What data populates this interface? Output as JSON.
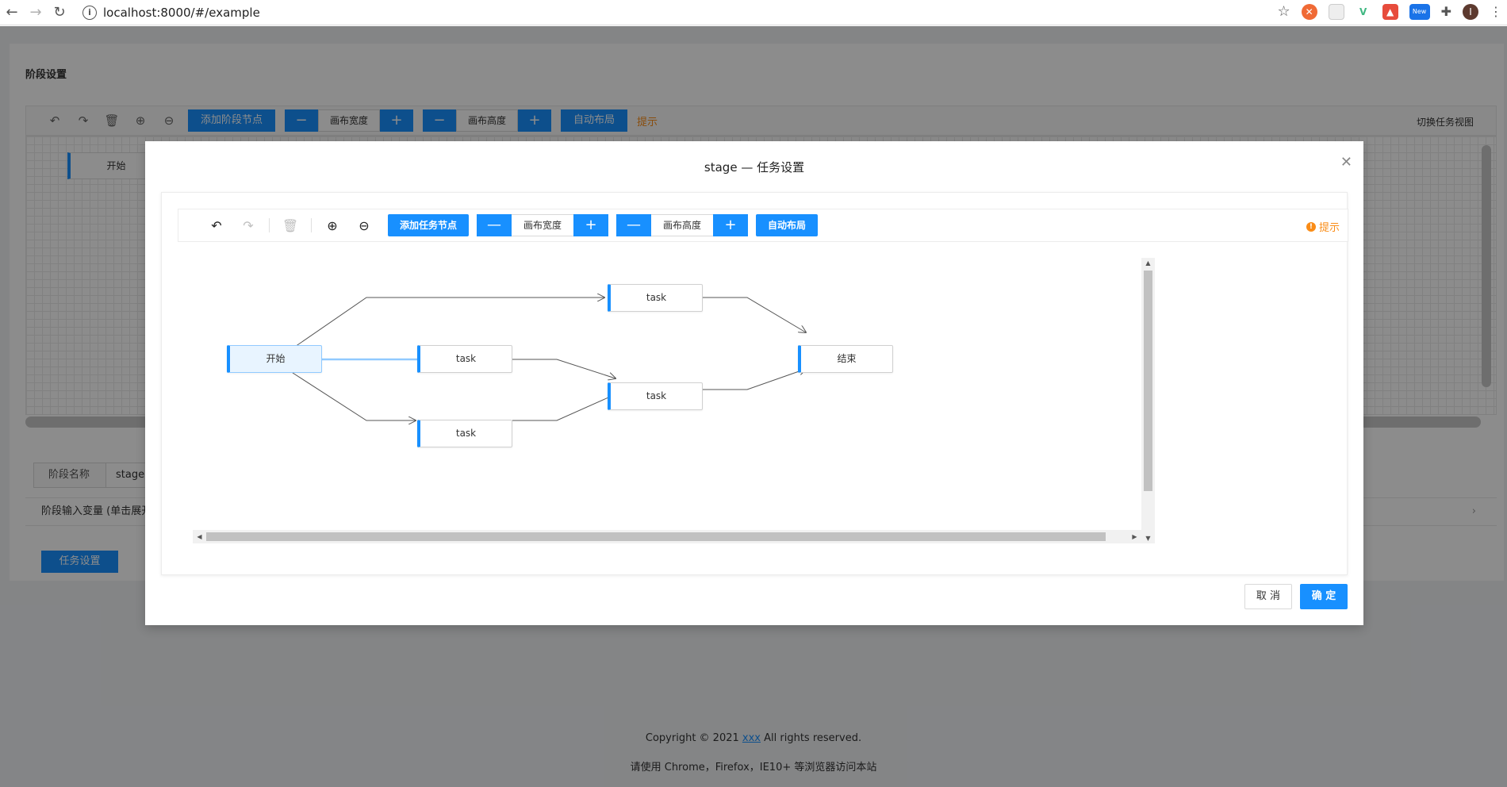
{
  "browser": {
    "url": "localhost:8000/#/example",
    "ext_new_badge": "New",
    "profile_initial": "I"
  },
  "stage_page": {
    "title": "阶段设置",
    "toolbar": {
      "add_stage_node": "添加阶段节点",
      "canvas_width": "画布宽度",
      "canvas_height": "画布高度",
      "auto_layout": "自动布局",
      "hint": "提示",
      "switch_view": "切换任务视图"
    },
    "start_node": "开始",
    "stage_name_label": "阶段名称",
    "stage_name_value": "stage",
    "input_vars_label": "阶段输入变量 (单击展开",
    "task_settings_button": "任务设置"
  },
  "footer": {
    "copyright_prefix": "Copyright © 2021",
    "copyright_link": "xxx",
    "copyright_suffix": "All rights reserved.",
    "browser_hint": "请使用 Chrome，Firefox，IE10+ 等浏览器访问本站"
  },
  "modal": {
    "title": "stage — 任务设置",
    "toolbar": {
      "add_task_node": "添加任务节点",
      "minus": "—",
      "plus": "+",
      "canvas_width": "画布宽度",
      "canvas_height": "画布高度",
      "auto_layout": "自动布局",
      "hint": "提示"
    },
    "nodes": {
      "start": "开始",
      "task_a": "task",
      "task_b": "task",
      "task_c": "task",
      "task_d": "task",
      "end": "结束"
    },
    "cancel": "取 消",
    "ok": "确 定"
  },
  "colors": {
    "primary": "#1890ff",
    "warning": "#fa8c16",
    "edge": "#555555",
    "edge_selected": "#91caff"
  }
}
